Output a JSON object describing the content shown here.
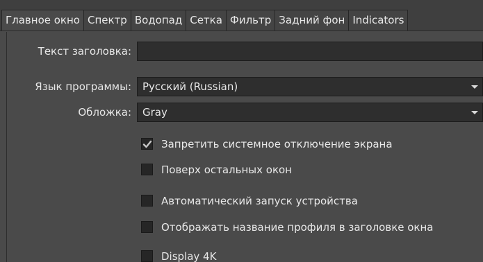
{
  "tabs": [
    {
      "label": "Главное окно",
      "active": true
    },
    {
      "label": "Спектр",
      "active": false
    },
    {
      "label": "Водопад",
      "active": false
    },
    {
      "label": "Сетка",
      "active": false
    },
    {
      "label": "Фильтр",
      "active": false
    },
    {
      "label": "Задний фон",
      "active": false
    },
    {
      "label": "Indicators",
      "active": false
    }
  ],
  "form": {
    "title_text": {
      "label": "Текст заголовка:",
      "value": ""
    },
    "language": {
      "label": "Язык программы:",
      "value": "Русский (Russian)"
    },
    "skin": {
      "label": "Обложка:",
      "value": "Gray"
    }
  },
  "checkboxes": [
    {
      "label": "Запретить системное отключение экрана",
      "checked": true
    },
    {
      "label": "Поверх остальных окон",
      "checked": false
    },
    {
      "label": "Автоматический запуск устройства",
      "checked": false
    },
    {
      "label": "Отображать название профиля в заголовке окна",
      "checked": false
    },
    {
      "label": "Display 4K",
      "checked": false
    }
  ],
  "colors": {
    "background": "#4a4a4a",
    "field": "#2e2e2e",
    "text": "#e6e6e6"
  }
}
